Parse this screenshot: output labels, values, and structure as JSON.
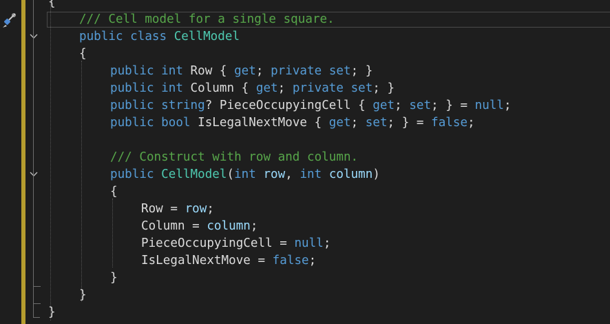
{
  "editor": {
    "lines": [
      {
        "indent": 0,
        "tokens": [
          {
            "t": "{",
            "c": "pu"
          }
        ]
      },
      {
        "indent": 1,
        "tokens": [
          {
            "t": "/// Cell model for a single square.",
            "c": "cm"
          }
        ]
      },
      {
        "indent": 1,
        "tokens": [
          {
            "t": "public",
            "c": "kw"
          },
          {
            "t": " ",
            "c": "pu"
          },
          {
            "t": "class",
            "c": "kw"
          },
          {
            "t": " ",
            "c": "pu"
          },
          {
            "t": "CellModel",
            "c": "ty"
          }
        ]
      },
      {
        "indent": 1,
        "tokens": [
          {
            "t": "{",
            "c": "pu"
          }
        ]
      },
      {
        "indent": 2,
        "tokens": [
          {
            "t": "public",
            "c": "kw"
          },
          {
            "t": " ",
            "c": "pu"
          },
          {
            "t": "int",
            "c": "kw"
          },
          {
            "t": " Row { ",
            "c": "pr"
          },
          {
            "t": "get",
            "c": "kw"
          },
          {
            "t": "; ",
            "c": "pu"
          },
          {
            "t": "private",
            "c": "kw"
          },
          {
            "t": " ",
            "c": "pu"
          },
          {
            "t": "set",
            "c": "kw"
          },
          {
            "t": "; }",
            "c": "pu"
          }
        ]
      },
      {
        "indent": 2,
        "tokens": [
          {
            "t": "public",
            "c": "kw"
          },
          {
            "t": " ",
            "c": "pu"
          },
          {
            "t": "int",
            "c": "kw"
          },
          {
            "t": " Column { ",
            "c": "pr"
          },
          {
            "t": "get",
            "c": "kw"
          },
          {
            "t": "; ",
            "c": "pu"
          },
          {
            "t": "private",
            "c": "kw"
          },
          {
            "t": " ",
            "c": "pu"
          },
          {
            "t": "set",
            "c": "kw"
          },
          {
            "t": "; }",
            "c": "pu"
          }
        ]
      },
      {
        "indent": 2,
        "tokens": [
          {
            "t": "public",
            "c": "kw"
          },
          {
            "t": " ",
            "c": "pu"
          },
          {
            "t": "string",
            "c": "kw"
          },
          {
            "t": "? PieceOccupyingCell { ",
            "c": "pr"
          },
          {
            "t": "get",
            "c": "kw"
          },
          {
            "t": "; ",
            "c": "pu"
          },
          {
            "t": "set",
            "c": "kw"
          },
          {
            "t": "; } = ",
            "c": "pu"
          },
          {
            "t": "null",
            "c": "kw"
          },
          {
            "t": ";",
            "c": "pu"
          }
        ]
      },
      {
        "indent": 2,
        "tokens": [
          {
            "t": "public",
            "c": "kw"
          },
          {
            "t": " ",
            "c": "pu"
          },
          {
            "t": "bool",
            "c": "kw"
          },
          {
            "t": " IsLegalNextMove { ",
            "c": "pr"
          },
          {
            "t": "get",
            "c": "kw"
          },
          {
            "t": "; ",
            "c": "pu"
          },
          {
            "t": "set",
            "c": "kw"
          },
          {
            "t": "; } = ",
            "c": "pu"
          },
          {
            "t": "false",
            "c": "kw"
          },
          {
            "t": ";",
            "c": "pu"
          }
        ]
      },
      {
        "indent": 0,
        "tokens": []
      },
      {
        "indent": 2,
        "tokens": [
          {
            "t": "/// Construct with row and column.",
            "c": "cm"
          }
        ]
      },
      {
        "indent": 2,
        "tokens": [
          {
            "t": "public",
            "c": "kw"
          },
          {
            "t": " ",
            "c": "pu"
          },
          {
            "t": "CellModel",
            "c": "ty"
          },
          {
            "t": "(",
            "c": "pu"
          },
          {
            "t": "int",
            "c": "kw"
          },
          {
            "t": " ",
            "c": "pu"
          },
          {
            "t": "row",
            "c": "pa"
          },
          {
            "t": ", ",
            "c": "pu"
          },
          {
            "t": "int",
            "c": "kw"
          },
          {
            "t": " ",
            "c": "pu"
          },
          {
            "t": "column",
            "c": "pa"
          },
          {
            "t": ")",
            "c": "pu"
          }
        ]
      },
      {
        "indent": 2,
        "tokens": [
          {
            "t": "{",
            "c": "pu"
          }
        ]
      },
      {
        "indent": 3,
        "tokens": [
          {
            "t": "Row = ",
            "c": "pr"
          },
          {
            "t": "row",
            "c": "pa"
          },
          {
            "t": ";",
            "c": "pu"
          }
        ]
      },
      {
        "indent": 3,
        "tokens": [
          {
            "t": "Column = ",
            "c": "pr"
          },
          {
            "t": "column",
            "c": "pa"
          },
          {
            "t": ";",
            "c": "pu"
          }
        ]
      },
      {
        "indent": 3,
        "tokens": [
          {
            "t": "PieceOccupyingCell = ",
            "c": "pr"
          },
          {
            "t": "null",
            "c": "kw"
          },
          {
            "t": ";",
            "c": "pu"
          }
        ]
      },
      {
        "indent": 3,
        "tokens": [
          {
            "t": "IsLegalNextMove = ",
            "c": "pr"
          },
          {
            "t": "false",
            "c": "kw"
          },
          {
            "t": ";",
            "c": "pu"
          }
        ]
      },
      {
        "indent": 2,
        "tokens": [
          {
            "t": "}",
            "c": "pu"
          }
        ]
      },
      {
        "indent": 1,
        "tokens": [
          {
            "t": "}",
            "c": "pu"
          }
        ]
      },
      {
        "indent": 0,
        "tokens": [
          {
            "t": "}",
            "c": "pu"
          }
        ]
      }
    ]
  },
  "colors": {
    "background": "#1e1e1e",
    "keyword": "#569cd6",
    "type": "#4ec9b0",
    "comment": "#57a64a",
    "parameter": "#9cdcfe",
    "change_bar": "#b59d2e"
  },
  "icons": {
    "glyph_margin": "screwdriver-brush-icon",
    "fold": "chevron-down-icon"
  }
}
